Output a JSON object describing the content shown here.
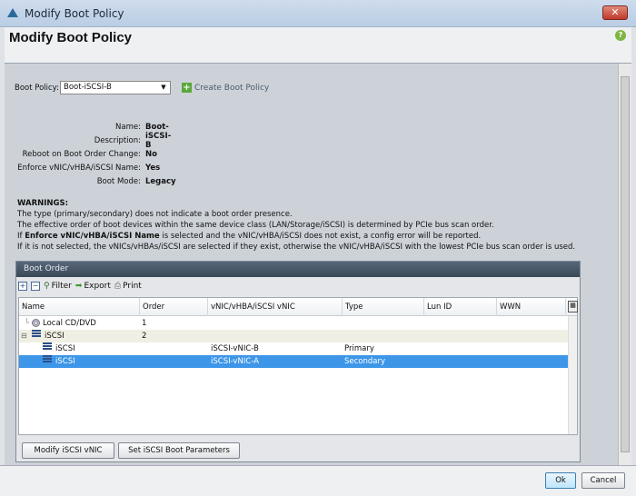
{
  "window": {
    "title": "Modify Boot Policy",
    "close": "✕"
  },
  "header": {
    "title": "Modify Boot Policy",
    "help": "?"
  },
  "boot_policy": {
    "label": "Boot Policy:",
    "value": "Boot-iSCSI-B",
    "create_label": "Create Boot Policy"
  },
  "properties": [
    {
      "label": "Name:",
      "value": "Boot-iSCSI-B"
    },
    {
      "label": "Description:",
      "value": ""
    },
    {
      "label": "Reboot on Boot Order Change:",
      "value": "No"
    },
    {
      "label": "Enforce vNIC/vHBA/iSCSI Name:",
      "value": "Yes"
    },
    {
      "label": "Boot Mode:",
      "value": "Legacy"
    }
  ],
  "warnings": {
    "title": "WARNINGS:",
    "line1": "The type (primary/secondary) does not indicate a boot order presence.",
    "line2": "The effective order of boot devices within the same device class (LAN/Storage/iSCSI) is determined by PCIe bus scan order.",
    "line3_pre": "If ",
    "line3_bold": "Enforce vNIC/vHBA/iSCSI Name",
    "line3_post": " is selected and the vNIC/vHBA/iSCSI does not exist, a config error will be reported.",
    "line4": "If it is not selected, the vNICs/vHBAs/iSCSI are selected if they exist, otherwise the vNIC/vHBA/iSCSI with the lowest PCIe bus scan order is used."
  },
  "boot_order": {
    "title": "Boot Order",
    "toolbar": {
      "filter": "Filter",
      "export": "Export",
      "print": "Print"
    },
    "columns": [
      "Name",
      "Order",
      "vNIC/vHBA/iSCSI vNIC",
      "Type",
      "Lun ID",
      "WWN"
    ],
    "rows": [
      {
        "name": "Local CD/DVD",
        "order": "1",
        "vnic": "",
        "type": ""
      },
      {
        "name": "iSCSI",
        "order": "2",
        "vnic": "",
        "type": ""
      },
      {
        "name": "iSCSI",
        "order": "",
        "vnic": "iSCSI-vNIC-B",
        "type": "Primary"
      },
      {
        "name": "iSCSI",
        "order": "",
        "vnic": "iSCSI-vNIC-A",
        "type": "Secondary"
      }
    ],
    "modify_button": "Modify iSCSI vNIC",
    "set_params_button": "Set iSCSI Boot Parameters"
  },
  "footer": {
    "ok": "Ok",
    "cancel": "Cancel"
  }
}
